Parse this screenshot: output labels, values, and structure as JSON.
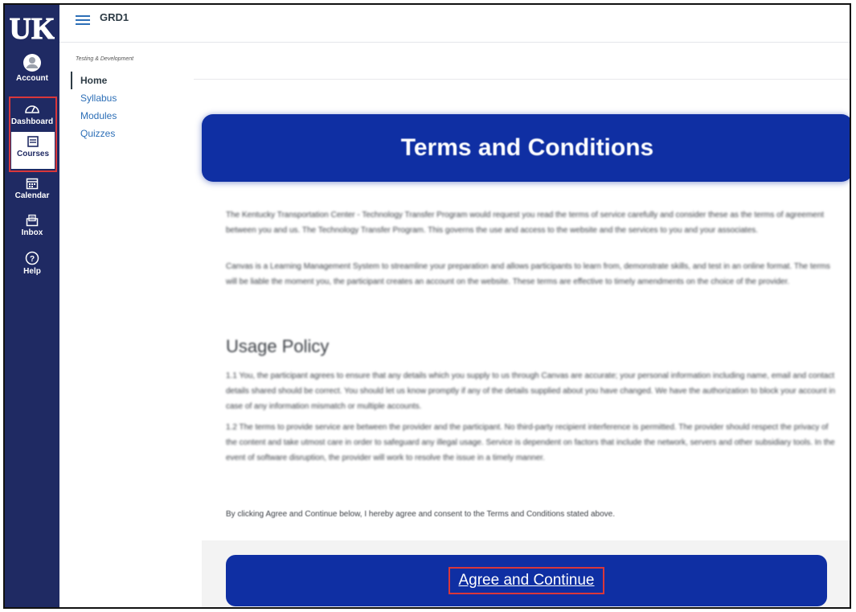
{
  "global_nav": {
    "account": "Account",
    "dashboard": "Dashboard",
    "courses": "Courses",
    "calendar": "Calendar",
    "inbox": "Inbox",
    "help": "Help"
  },
  "topbar": {
    "course_code": "GRD1"
  },
  "course_nav": {
    "title": "Testing & Development",
    "items": [
      "Home",
      "Syllabus",
      "Modules",
      "Quizzes"
    ]
  },
  "page": {
    "banner_title": "Terms and Conditions",
    "intro_1": "The Kentucky Transportation Center - Technology Transfer Program would request you read the terms of service carefully and consider these as the terms of agreement between you and us. The Technology Transfer Program. This governs the use and access to the website and the services to you and your associates.",
    "intro_2": "Canvas is a Learning Management System to streamline your preparation and allows participants to learn from, demonstrate skills, and test in an online format. The terms will be liable the moment you, the participant creates an account on the website. These terms are effective to timely amendments on the choice of the provider.",
    "usage_heading": "Usage Policy",
    "policy_1_1": "1.1 You, the participant agrees to ensure that any details which you supply to us through Canvas are accurate; your personal information including name, email and contact details shared should be correct. You should let us know promptly if any of the details supplied about you have changed. We have the authorization to block your account in case of any information mismatch or multiple accounts.",
    "policy_1_2": "1.2 The terms to provide service are between the provider and the participant. No third-party recipient interference is permitted. The provider should respect the privacy of the content and take utmost care in order to safeguard any illegal usage. Service is dependent on factors that include the network, servers and other subsidiary tools. In the event of software disruption, the provider will work to resolve the issue in a timely manner.",
    "consent": "By clicking Agree and Continue below, I hereby agree and consent to the Terms and Conditions stated above.",
    "agree_button": "Agree and Continue"
  },
  "colors": {
    "nav_bg": "#1f2a63",
    "banner": "#0f2fa3",
    "highlight": "#d9373a",
    "link": "#2d6fb7"
  }
}
